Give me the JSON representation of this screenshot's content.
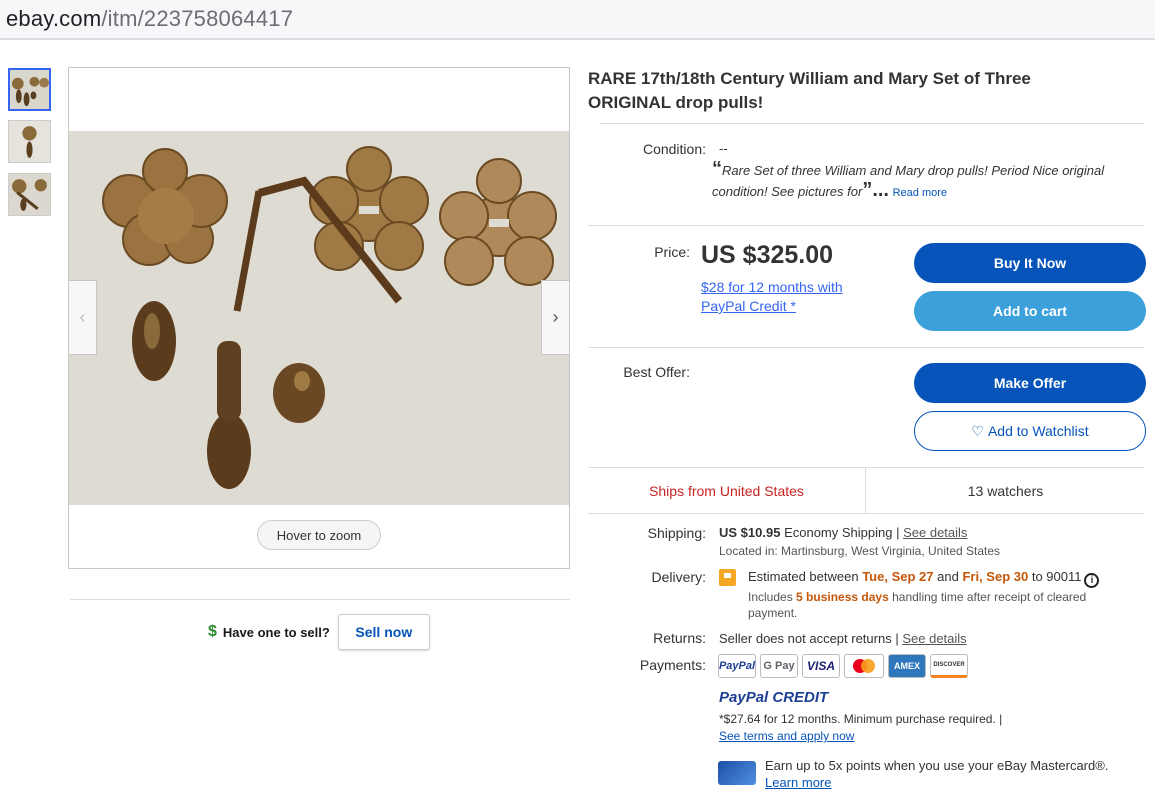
{
  "browser": {
    "url_host": "ebay.com",
    "url_path": "/itm/223758064417"
  },
  "gallery": {
    "prev_icon": "‹",
    "next_icon": "›",
    "zoom_hint": "Hover to zoom"
  },
  "sell": {
    "dollar_icon": "$",
    "question": "Have one to sell?",
    "button": "Sell now"
  },
  "item": {
    "title": "RARE 17th/18th Century William and Mary Set of Three ORIGINAL drop pulls!",
    "condition_label": "Condition:",
    "condition_value": "--",
    "description_open": "“",
    "description": "Rare Set of three William and Mary drop pulls! Period Nice original condition! See pictures for",
    "description_close": "”...",
    "read_more": "Read more",
    "price_label": "Price:",
    "price": "US $325.00",
    "paypal_credit_offer": "$28 for 12 months with PayPal Credit",
    "paypal_credit_asterisk": "*",
    "buy_now": "Buy It Now",
    "add_to_cart": "Add to cart",
    "best_offer_label": "Best Offer:",
    "make_offer": "Make Offer",
    "watchlist_icon": "♡",
    "add_to_watchlist": "Add to Watchlist",
    "ships_from": "Ships from United States",
    "watchers": "13 watchers"
  },
  "shipping": {
    "label": "Shipping:",
    "cost": "US $10.95",
    "method": "Economy Shipping",
    "separator": "|",
    "see_details": "See details",
    "location": "Located in: Martinsburg, West Virginia, United States"
  },
  "delivery": {
    "label": "Delivery:",
    "prefix": "Estimated between",
    "date_from": "Tue, Sep 27",
    "and": "and",
    "date_to": "Fri, Sep 30",
    "to_zip": "to 90011",
    "info_icon": "i",
    "includes": "Includes",
    "handling_days": "5 business days",
    "handling_rest": "handling time after receipt of cleared payment."
  },
  "returns": {
    "label": "Returns:",
    "text": "Seller does not accept returns",
    "separator": "|",
    "see_details": "See details"
  },
  "payments": {
    "label": "Payments:",
    "methods": [
      "PayPal",
      "G Pay",
      "VISA",
      "Mastercard",
      "AMEX",
      "DISCOVER"
    ],
    "paypal_credit_logo_a": "PayPal",
    "paypal_credit_logo_b": "CREDIT",
    "credit_terms": "*$27.64 for 12 months. Minimum purchase required. |",
    "terms_link": "See terms and apply now",
    "mastercard_promo": "Earn up to 5x points when you use your eBay Mastercard®.",
    "learn_more": "Learn more"
  },
  "colors": {
    "accent": "#0654ba",
    "cart": "#3ca0da",
    "ships": "#c72323",
    "date": "#c4570a"
  }
}
